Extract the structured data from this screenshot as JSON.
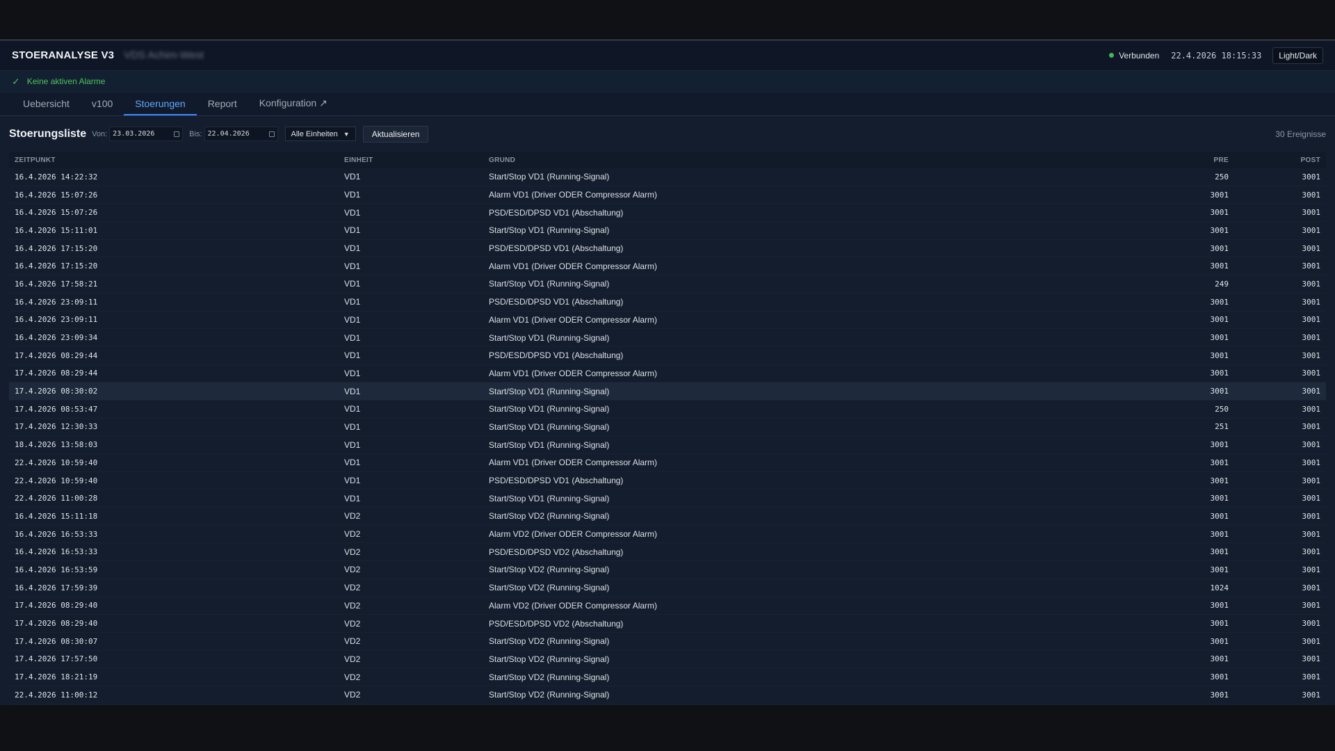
{
  "header": {
    "app_title": "STOERANALYSE V3",
    "site_name": "VDS Achim-West",
    "connection_status": "Verbunden",
    "clock": "22.4.2026 18:15:33",
    "theme_toggle": "Light/Dark",
    "status_color": "#3fb950"
  },
  "alarm": {
    "text": "Keine aktiven Alarme",
    "icon": "check-icon"
  },
  "tabs": [
    {
      "label": "Uebersicht",
      "active": false
    },
    {
      "label": "v100",
      "active": false
    },
    {
      "label": "Stoerungen",
      "active": true
    },
    {
      "label": "Report",
      "active": false
    },
    {
      "label": "Konfiguration ↗",
      "active": false
    }
  ],
  "toolbar": {
    "title": "Stoerungsliste",
    "from_label": "Von:",
    "from_value": "23.03.2026",
    "to_label": "Bis:",
    "to_value": "22.04.2026",
    "unit_filter": "Alle Einheiten",
    "refresh_label": "Aktualisieren",
    "event_count": "30 Ereignisse"
  },
  "table": {
    "columns": [
      "ZEITPUNKT",
      "EINHEIT",
      "GRUND",
      "PRE",
      "POST"
    ],
    "highlighted_row": 12,
    "rows": [
      [
        "16.4.2026 14:22:32",
        "VD1",
        "Start/Stop VD1 (Running-Signal)",
        "250",
        "3001"
      ],
      [
        "16.4.2026 15:07:26",
        "VD1",
        "Alarm VD1 (Driver ODER Compressor Alarm)",
        "3001",
        "3001"
      ],
      [
        "16.4.2026 15:07:26",
        "VD1",
        "PSD/ESD/DPSD VD1 (Abschaltung)",
        "3001",
        "3001"
      ],
      [
        "16.4.2026 15:11:01",
        "VD1",
        "Start/Stop VD1 (Running-Signal)",
        "3001",
        "3001"
      ],
      [
        "16.4.2026 17:15:20",
        "VD1",
        "PSD/ESD/DPSD VD1 (Abschaltung)",
        "3001",
        "3001"
      ],
      [
        "16.4.2026 17:15:20",
        "VD1",
        "Alarm VD1 (Driver ODER Compressor Alarm)",
        "3001",
        "3001"
      ],
      [
        "16.4.2026 17:58:21",
        "VD1",
        "Start/Stop VD1 (Running-Signal)",
        "249",
        "3001"
      ],
      [
        "16.4.2026 23:09:11",
        "VD1",
        "PSD/ESD/DPSD VD1 (Abschaltung)",
        "3001",
        "3001"
      ],
      [
        "16.4.2026 23:09:11",
        "VD1",
        "Alarm VD1 (Driver ODER Compressor Alarm)",
        "3001",
        "3001"
      ],
      [
        "16.4.2026 23:09:34",
        "VD1",
        "Start/Stop VD1 (Running-Signal)",
        "3001",
        "3001"
      ],
      [
        "17.4.2026 08:29:44",
        "VD1",
        "PSD/ESD/DPSD VD1 (Abschaltung)",
        "3001",
        "3001"
      ],
      [
        "17.4.2026 08:29:44",
        "VD1",
        "Alarm VD1 (Driver ODER Compressor Alarm)",
        "3001",
        "3001"
      ],
      [
        "17.4.2026 08:30:02",
        "VD1",
        "Start/Stop VD1 (Running-Signal)",
        "3001",
        "3001"
      ],
      [
        "17.4.2026 08:53:47",
        "VD1",
        "Start/Stop VD1 (Running-Signal)",
        "250",
        "3001"
      ],
      [
        "17.4.2026 12:30:33",
        "VD1",
        "Start/Stop VD1 (Running-Signal)",
        "251",
        "3001"
      ],
      [
        "18.4.2026 13:58:03",
        "VD1",
        "Start/Stop VD1 (Running-Signal)",
        "3001",
        "3001"
      ],
      [
        "22.4.2026 10:59:40",
        "VD1",
        "Alarm VD1 (Driver ODER Compressor Alarm)",
        "3001",
        "3001"
      ],
      [
        "22.4.2026 10:59:40",
        "VD1",
        "PSD/ESD/DPSD VD1 (Abschaltung)",
        "3001",
        "3001"
      ],
      [
        "22.4.2026 11:00:28",
        "VD1",
        "Start/Stop VD1 (Running-Signal)",
        "3001",
        "3001"
      ],
      [
        "16.4.2026 15:11:18",
        "VD2",
        "Start/Stop VD2 (Running-Signal)",
        "3001",
        "3001"
      ],
      [
        "16.4.2026 16:53:33",
        "VD2",
        "Alarm VD2 (Driver ODER Compressor Alarm)",
        "3001",
        "3001"
      ],
      [
        "16.4.2026 16:53:33",
        "VD2",
        "PSD/ESD/DPSD VD2 (Abschaltung)",
        "3001",
        "3001"
      ],
      [
        "16.4.2026 16:53:59",
        "VD2",
        "Start/Stop VD2 (Running-Signal)",
        "3001",
        "3001"
      ],
      [
        "16.4.2026 17:59:39",
        "VD2",
        "Start/Stop VD2 (Running-Signal)",
        "1024",
        "3001"
      ],
      [
        "17.4.2026 08:29:40",
        "VD2",
        "Alarm VD2 (Driver ODER Compressor Alarm)",
        "3001",
        "3001"
      ],
      [
        "17.4.2026 08:29:40",
        "VD2",
        "PSD/ESD/DPSD VD2 (Abschaltung)",
        "3001",
        "3001"
      ],
      [
        "17.4.2026 08:30:07",
        "VD2",
        "Start/Stop VD2 (Running-Signal)",
        "3001",
        "3001"
      ],
      [
        "17.4.2026 17:57:50",
        "VD2",
        "Start/Stop VD2 (Running-Signal)",
        "3001",
        "3001"
      ],
      [
        "17.4.2026 18:21:19",
        "VD2",
        "Start/Stop VD2 (Running-Signal)",
        "3001",
        "3001"
      ],
      [
        "22.4.2026 11:00:12",
        "VD2",
        "Start/Stop VD2 (Running-Signal)",
        "3001",
        "3001"
      ]
    ]
  }
}
